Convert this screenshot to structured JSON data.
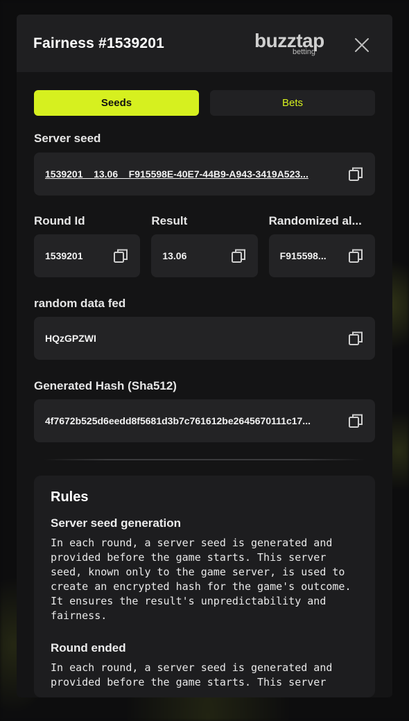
{
  "modal": {
    "title": "Fairness #1539201",
    "logo_main": "buzztap",
    "logo_sub": "betting"
  },
  "tabs": [
    {
      "label": "Seeds",
      "active": true
    },
    {
      "label": "Bets",
      "active": false
    }
  ],
  "server_seed": {
    "label": "Server seed",
    "value": "1539201 _ 13.06 _ F915598E-40E7-44B9-A943-3419A523..."
  },
  "round_id": {
    "label": "Round Id",
    "value": "1539201"
  },
  "result": {
    "label": "Result",
    "value": "13.06"
  },
  "randomized": {
    "label": "Randomized al...",
    "value": "F915598..."
  },
  "random_data": {
    "label": "random data fed",
    "value": "HQzGPZWI"
  },
  "generated_hash": {
    "label": "Generated Hash (Sha512)",
    "value": "4f7672b525d6eedd8f5681d3b7c761612be2645670111c17..."
  },
  "rules": {
    "title": "Rules",
    "sections": [
      {
        "heading": "Server seed generation",
        "text": "In each round, a server seed is generated and provided before the game starts. This server seed, known only to the game server, is used to create an encrypted hash for the game's outcome. It ensures the result's unpredictability and fairness."
      },
      {
        "heading": "Round ended",
        "text": "In each round, a server seed is generated and provided before the game starts. This server"
      }
    ]
  },
  "colors": {
    "accent": "#d6f01f",
    "modal_bg": "#141415",
    "field_bg": "#232325"
  },
  "icons": {
    "close": "close-icon",
    "copy": "copy-icon"
  }
}
